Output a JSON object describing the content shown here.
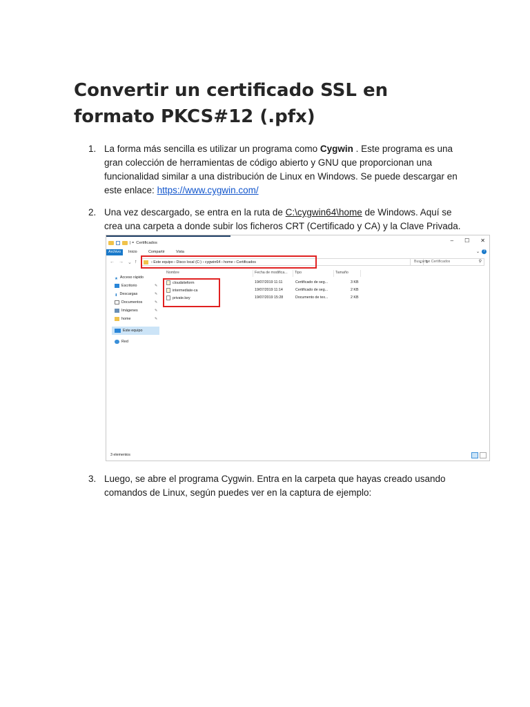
{
  "doc": {
    "title": "Convertir un certificado SSL en formato PKCS#12 (.pfx)",
    "items": [
      {
        "num": "1.",
        "pre": "La forma más sencilla es utilizar un programa como ",
        "bold": "Cygwin",
        "mid": " . Este programa es una gran colección de herramientas de código abierto y GNU que proporcionan una funcionalidad similar a una distribución de Linux en Windows. Se puede descargar en este enlace: ",
        "link": "https://www.cygwin.com/"
      },
      {
        "num": "2.",
        "pre": "Una vez descargado, se entra en la ruta de ",
        "path": "C:\\cygwin64\\home",
        "post": " de Windows. Aquí se crea una carpeta a donde subir los ficheros CRT (Certificado y CA) y la Clave Privada."
      },
      {
        "num": "3.",
        "text": "Luego, se abre el programa Cygwin. Entra en la carpeta que hayas creado usando comandos de Linux, según puedes ver en la captura de ejemplo:"
      }
    ]
  },
  "explorer": {
    "window_title": "Certificados",
    "qa_sep": "| =",
    "controls": {
      "min": "–",
      "max": "☐",
      "close": "✕"
    },
    "ribbon_tabs": [
      "Archivo",
      "Inicio",
      "Compartir",
      "Vista"
    ],
    "help": "?",
    "path": "› Este equipo › Disco local (C:) › cygwin64 › home › Certificados",
    "search_placeholder": "Buscar en Certificados",
    "columns": [
      "Nombre",
      "Fecha de modifica...",
      "Tipo",
      "Tamaño"
    ],
    "nav": [
      {
        "label": "Acceso rápido",
        "icon": "star-icon",
        "pinned": false
      },
      {
        "label": "Escritorio",
        "icon": "desktop-icon",
        "pinned": true
      },
      {
        "label": "Descargas",
        "icon": "download-icon",
        "pinned": true
      },
      {
        "label": "Documentos",
        "icon": "documents-icon",
        "pinned": true
      },
      {
        "label": "Imágenes",
        "icon": "images-icon",
        "pinned": true
      },
      {
        "label": "home",
        "icon": "folder-icon",
        "pinned": true
      },
      {
        "label": "Este equipo",
        "icon": "computer-icon",
        "pinned": false
      },
      {
        "label": "Red",
        "icon": "network-icon",
        "pinned": false
      }
    ],
    "pin_glyph": "✎",
    "files": [
      {
        "name": "cloudsiteform",
        "date": "19/07/2019 11:11",
        "type": "Certificado de seg...",
        "size": "3 KB"
      },
      {
        "name": "intermediate-ca",
        "date": "19/07/2019 11:14",
        "type": "Certificado de seg...",
        "size": "2 KB"
      },
      {
        "name": "private.key",
        "date": "19/07/2019 15:28",
        "type": "Documento de tex...",
        "size": "2 KB"
      }
    ],
    "status": "3 elementos",
    "colors": {
      "accent": "#1979ca",
      "highlight": "#e02020",
      "selection": "#cce4f7"
    }
  }
}
